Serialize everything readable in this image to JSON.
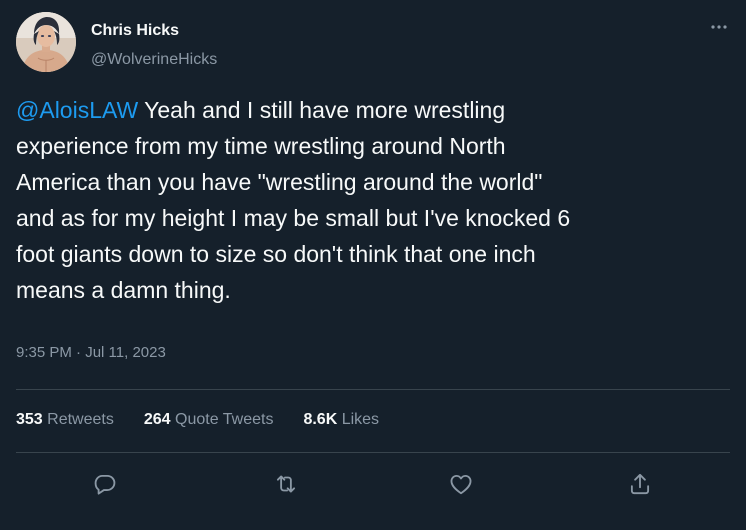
{
  "author": {
    "display_name": "Chris Hicks",
    "handle": "@WolverineHicks"
  },
  "tweet": {
    "mention": "@AloisLAW",
    "body": " Yeah and I still have more wrestling\nexperience from my time wrestling around North\nAmerica than you have \"wrestling around the world\"\nand as for my height I may be small but I've knocked 6\nfoot giants down to size so don't think that one inch\nmeans a damn thing.",
    "timestamp": "9:35 PM · Jul 11, 2023"
  },
  "stats": {
    "retweets": {
      "count": "353",
      "label": "Retweets"
    },
    "quotes": {
      "count": "264",
      "label": "Quote Tweets"
    },
    "likes": {
      "count": "8.6K",
      "label": "Likes"
    }
  },
  "icons": {
    "more": "more-horizontal-icon",
    "reply": "reply-icon",
    "retweet": "retweet-icon",
    "like": "like-icon",
    "share": "share-icon"
  },
  "colors": {
    "background": "#15202b",
    "text_primary": "#f7f9f9",
    "text_secondary": "#8b98a5",
    "accent": "#1d9bf0",
    "divider": "#38444d"
  }
}
